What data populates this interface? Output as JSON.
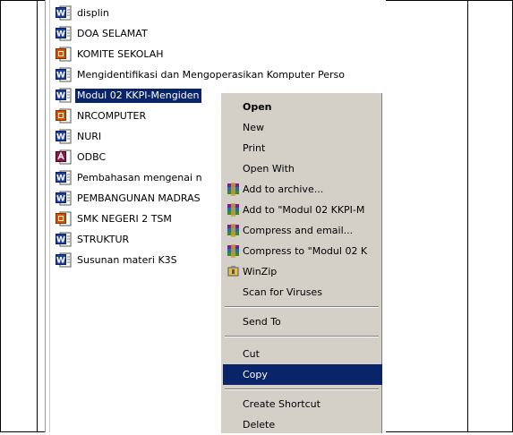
{
  "files": [
    {
      "name": "displin",
      "type": "word"
    },
    {
      "name": "DOA SELAMAT",
      "type": "word"
    },
    {
      "name": "KOMITE SEKOLAH",
      "type": "ppt"
    },
    {
      "name": "Mengidentifikasi dan Mengoperasikan Komputer Perso",
      "type": "word"
    },
    {
      "name": "Modul 02 KKPI-Mengiden",
      "type": "word"
    },
    {
      "name": "NRCOMPUTER",
      "type": "ppt"
    },
    {
      "name": "NURI",
      "type": "word"
    },
    {
      "name": "ODBC",
      "type": "access"
    },
    {
      "name": "Pembahasan mengenai n",
      "type": "word"
    },
    {
      "name": "PEMBANGUNAN MADRAS",
      "type": "word"
    },
    {
      "name": "SMK NEGERI 2 TSM",
      "type": "ppt"
    },
    {
      "name": "STRUKTUR",
      "type": "word"
    },
    {
      "name": "Susunan materi K3S",
      "type": "word"
    }
  ],
  "context_menu": {
    "open": "Open",
    "new": "New",
    "print": "Print",
    "open_with": "Open With",
    "add_to_archive": "Add to archive...",
    "add_to_named": "Add to \"Modul 02 KKPI-M",
    "compress_email": "Compress and email...",
    "compress_to": "Compress to \"Modul 02 K",
    "winzip": "WinZip",
    "scan": "Scan for Viruses",
    "send_to": "Send To",
    "cut": "Cut",
    "copy": "Copy",
    "create_shortcut": "Create Shortcut",
    "delete": "Delete"
  },
  "colors": {
    "selection": "#0a246a",
    "menu_bg": "#d4d0c8",
    "word_icon": "#1f3f9f",
    "ppt_icon": "#d35400",
    "access_icon": "#8b1a4a"
  }
}
